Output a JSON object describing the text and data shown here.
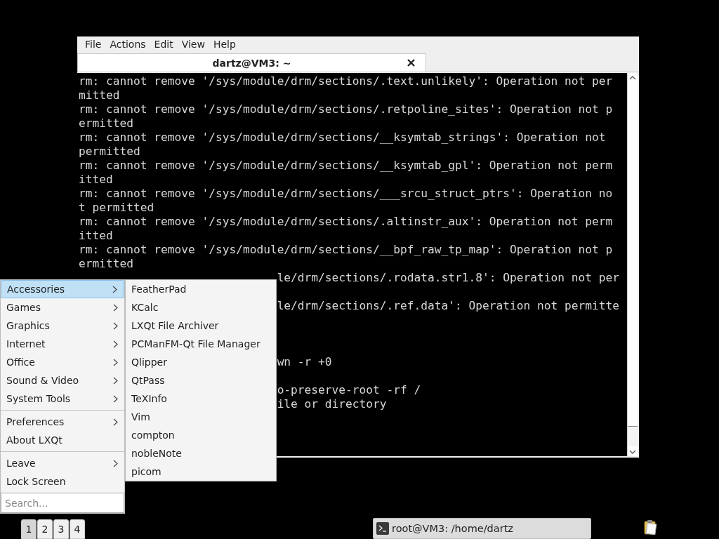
{
  "terminal": {
    "menu": [
      "File",
      "Actions",
      "Edit",
      "View",
      "Help"
    ],
    "tab": {
      "title": "dartz@VM3: ~"
    },
    "lines": [
      {
        "kind": "full",
        "text": "rm: cannot remove '/sys/module/drm/sections/.text.unlikely': Operation not per"
      },
      {
        "kind": "full",
        "text": "mitted"
      },
      {
        "kind": "full",
        "text": "rm: cannot remove '/sys/module/drm/sections/.retpoline_sites': Operation not p"
      },
      {
        "kind": "full",
        "text": "ermitted"
      },
      {
        "kind": "full",
        "text": "rm: cannot remove '/sys/module/drm/sections/__ksymtab_strings': Operation not"
      },
      {
        "kind": "full",
        "text": "permitted"
      },
      {
        "kind": "full",
        "text": "rm: cannot remove '/sys/module/drm/sections/__ksymtab_gpl': Operation not perm"
      },
      {
        "kind": "full",
        "text": "itted"
      },
      {
        "kind": "full",
        "text": "rm: cannot remove '/sys/module/drm/sections/___srcu_struct_ptrs': Operation no"
      },
      {
        "kind": "full",
        "text": "t permitted"
      },
      {
        "kind": "full",
        "text": "rm: cannot remove '/sys/module/drm/sections/.altinstr_aux': Operation not perm"
      },
      {
        "kind": "full",
        "text": "itted"
      },
      {
        "kind": "full",
        "text": "rm: cannot remove '/sys/module/drm/sections/__bpf_raw_tp_map': Operation not p"
      },
      {
        "kind": "full",
        "text": "ermitted"
      },
      {
        "kind": "covered",
        "text": "le/drm/sections/.rodata.str1.8': Operation not per"
      },
      {
        "kind": "blank"
      },
      {
        "kind": "covered",
        "text": "le/drm/sections/.ref.data': Operation not permitte"
      },
      {
        "kind": "blank"
      },
      {
        "kind": "blank"
      },
      {
        "kind": "blank"
      },
      {
        "kind": "covered",
        "text": "wn -r +0"
      },
      {
        "kind": "blank"
      },
      {
        "kind": "covered",
        "text": "o-preserve-root -rf /"
      },
      {
        "kind": "covered",
        "text": "ile or directory"
      }
    ]
  },
  "menu": {
    "groups": [
      [
        {
          "label": "Accessories",
          "has_submenu": true,
          "selected": true
        },
        {
          "label": "Games",
          "has_submenu": true,
          "selected": false
        },
        {
          "label": "Graphics",
          "has_submenu": true,
          "selected": false
        },
        {
          "label": "Internet",
          "has_submenu": true,
          "selected": false
        },
        {
          "label": "Office",
          "has_submenu": true,
          "selected": false
        },
        {
          "label": "Sound & Video",
          "has_submenu": true,
          "selected": false
        },
        {
          "label": "System Tools",
          "has_submenu": true,
          "selected": false
        }
      ],
      [
        {
          "label": "Preferences",
          "has_submenu": true,
          "selected": false
        },
        {
          "label": "About LXQt",
          "has_submenu": false,
          "selected": false
        }
      ],
      [
        {
          "label": "Leave",
          "has_submenu": true,
          "selected": false
        },
        {
          "label": "Lock Screen",
          "has_submenu": false,
          "selected": false
        }
      ]
    ],
    "search": {
      "placeholder": "Search..."
    }
  },
  "submenu": {
    "items": [
      "FeatherPad",
      "KCalc",
      "LXQt File Archiver",
      "PCManFM-Qt File Manager",
      "Qlipper",
      "QtPass",
      "TeXInfo",
      "Vim",
      "compton",
      "nobleNote",
      "picom"
    ]
  },
  "taskbar": {
    "desktops": [
      {
        "label": "1",
        "selected": true
      },
      {
        "label": "2",
        "selected": false
      },
      {
        "label": "3",
        "selected": false
      },
      {
        "label": "4",
        "selected": false
      }
    ],
    "tasks": [
      {
        "label": "root@VM3: /home/dartz"
      }
    ]
  }
}
